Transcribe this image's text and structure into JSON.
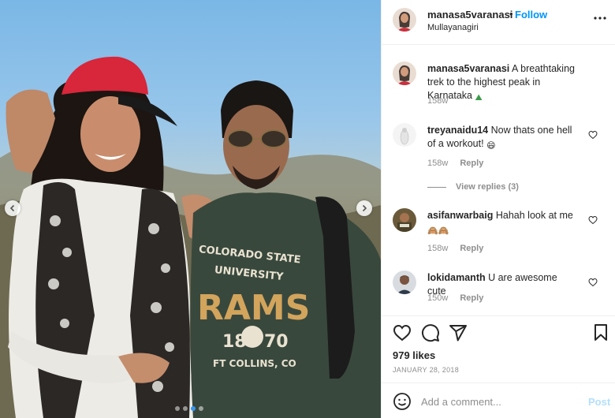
{
  "post": {
    "image_alt": "Two people posing on a mountain trek",
    "carousel": {
      "total": 4,
      "active_index": 3
    }
  },
  "header": {
    "username": "manasa5varanasi",
    "separator": "•",
    "follow_label": "Follow",
    "location": "Mullayanagiri"
  },
  "comments": [
    {
      "username": "manasa5varanasi",
      "text": "A breathtaking trek to the highest peak in Karnataka",
      "emoji": "⛰",
      "time": "158w",
      "is_caption": true
    },
    {
      "username": "treyanaidu14",
      "text": "Now thats one hell of a workout!",
      "emoji": "😄",
      "time": "158w",
      "reply_label": "Reply",
      "view_replies": "View replies (3)"
    },
    {
      "username": "asifanwarbaig",
      "text": "Hahah look at me",
      "emoji": "🙈🙈",
      "time": "158w",
      "reply_label": "Reply"
    },
    {
      "username": "lokidamanth",
      "text": "U are awesome cute",
      "emoji": "",
      "time": "150w",
      "reply_label": "Reply"
    }
  ],
  "actions": {
    "likes": "979 likes",
    "date": "JANUARY 28, 2018"
  },
  "add_comment": {
    "placeholder": "Add a comment...",
    "post_label": "Post"
  },
  "colors": {
    "follow": "#0095f6",
    "post_disabled": "#b2dffc",
    "meta_gray": "#8e8e8e",
    "text": "#262626",
    "divider": "#efefef"
  },
  "icons": [
    "chevron-left-icon",
    "chevron-right-icon",
    "more-options-icon",
    "heart-icon",
    "comment-icon",
    "share-icon",
    "bookmark-icon",
    "smiley-icon"
  ]
}
